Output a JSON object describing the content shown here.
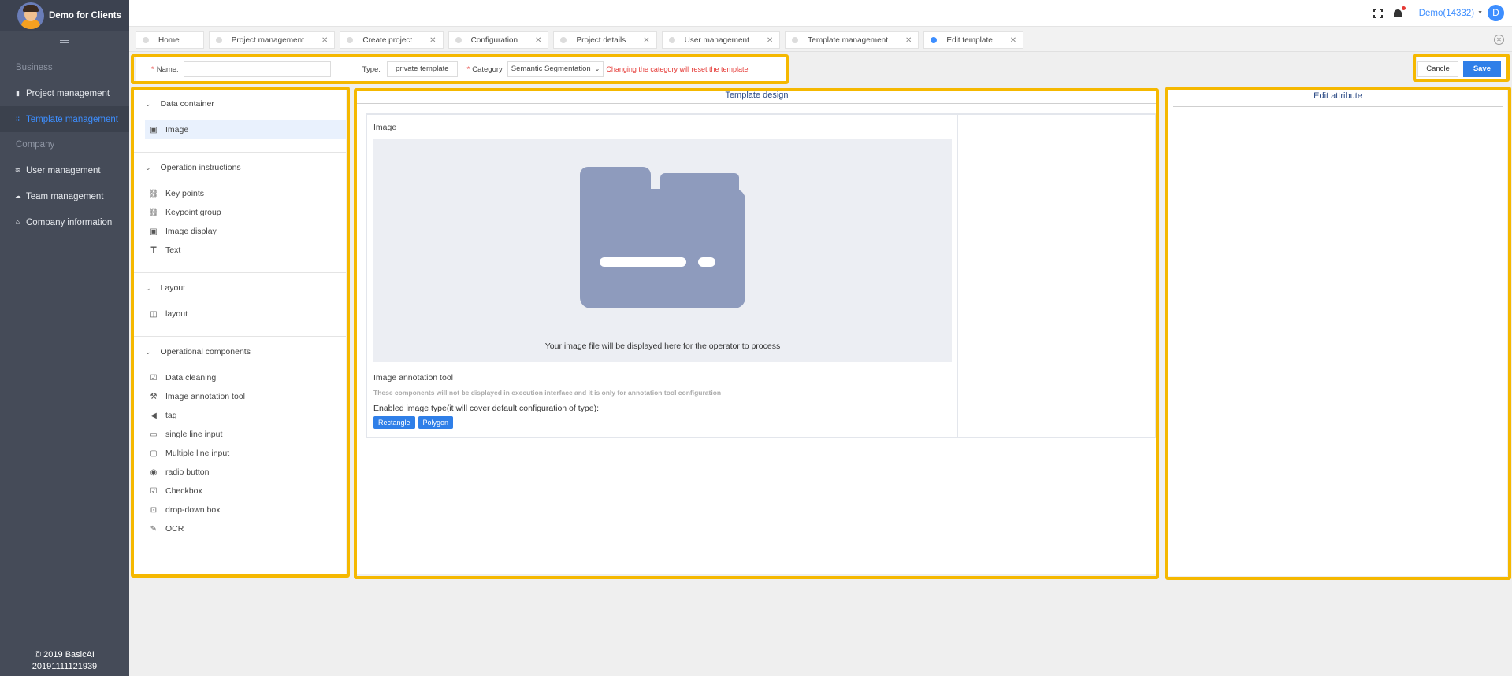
{
  "sidebar": {
    "brand": "Demo for Clients",
    "sections": [
      {
        "title": "Business",
        "items": [
          {
            "label": "Project management",
            "icon": "book-icon",
            "active": false
          },
          {
            "label": "Template management",
            "icon": "grid-icon",
            "active": true
          }
        ]
      },
      {
        "title": "Company",
        "items": [
          {
            "label": "User management",
            "icon": "users-icon",
            "active": false
          },
          {
            "label": "Team management",
            "icon": "team-icon",
            "active": false
          },
          {
            "label": "Company information",
            "icon": "home-icon",
            "active": false
          }
        ]
      }
    ],
    "footer_line1": "© 2019 BasicAI",
    "footer_line2": "20191111121939"
  },
  "topbar": {
    "user": "Demo(14332)",
    "avatar_letter": "D"
  },
  "tabs": [
    {
      "label": "Home",
      "active": false,
      "closable": false
    },
    {
      "label": "Project management",
      "active": false,
      "closable": true
    },
    {
      "label": "Create project",
      "active": false,
      "closable": true
    },
    {
      "label": "Configuration",
      "active": false,
      "closable": true
    },
    {
      "label": "Project details",
      "active": false,
      "closable": true
    },
    {
      "label": "User management",
      "active": false,
      "closable": true
    },
    {
      "label": "Template management",
      "active": false,
      "closable": true
    },
    {
      "label": "Edit template",
      "active": true,
      "closable": true
    }
  ],
  "form": {
    "name_label": "Name:",
    "name_value": "",
    "type_label": "Type:",
    "type_value": "private template",
    "category_label": "Category",
    "category_value": "Semantic Segmentation",
    "category_warning": "Changing the category will reset the template"
  },
  "actions": {
    "cancel": "Cancle",
    "save": "Save"
  },
  "components": [
    {
      "title": "Data container",
      "items": [
        {
          "label": "Image",
          "icon": "image-icon",
          "selected": true
        }
      ]
    },
    {
      "title": "Operation instructions",
      "items": [
        {
          "label": "Key points",
          "icon": "link-icon",
          "selected": false
        },
        {
          "label": "Keypoint group",
          "icon": "link-icon",
          "selected": false
        },
        {
          "label": "Image display",
          "icon": "image-icon",
          "selected": false
        },
        {
          "label": "Text",
          "icon": "text-icon",
          "selected": false
        }
      ]
    },
    {
      "title": "Layout",
      "items": [
        {
          "label": "layout",
          "icon": "layout-icon",
          "selected": false
        }
      ]
    },
    {
      "title": "Operational components",
      "items": [
        {
          "label": "Data cleaning",
          "icon": "check-square-icon",
          "selected": false
        },
        {
          "label": "Image annotation tool",
          "icon": "hammer-icon",
          "selected": false
        },
        {
          "label": "tag",
          "icon": "tag-icon",
          "selected": false
        },
        {
          "label": "single line input",
          "icon": "single-input-icon",
          "selected": false
        },
        {
          "label": "Multiple line input",
          "icon": "multi-input-icon",
          "selected": false
        },
        {
          "label": "radio button",
          "icon": "radio-icon",
          "selected": false
        },
        {
          "label": "Checkbox",
          "icon": "checkbox-icon",
          "selected": false
        },
        {
          "label": "drop-down box",
          "icon": "dropdown-icon",
          "selected": false
        },
        {
          "label": "OCR",
          "icon": "pen-icon",
          "selected": false
        }
      ]
    }
  ],
  "design": {
    "title": "Template design",
    "image_label": "Image",
    "image_caption": "Your image file will be displayed here for the operator to process",
    "tool_title": "Image annotation tool",
    "tool_desc": "These components will not be displayed in execution interface and it is only for annotation tool configuration",
    "enabled_label": "Enabled image type(it will cover default configuration of type):",
    "enabled_types": [
      "Rectangle",
      "Polygon"
    ]
  },
  "attributes": {
    "title": "Edit attribute"
  },
  "colors": {
    "accent": "#2f7fe8",
    "sidebar_bg": "#454b58",
    "highlight": "#f5b800",
    "warning": "#e53935"
  }
}
